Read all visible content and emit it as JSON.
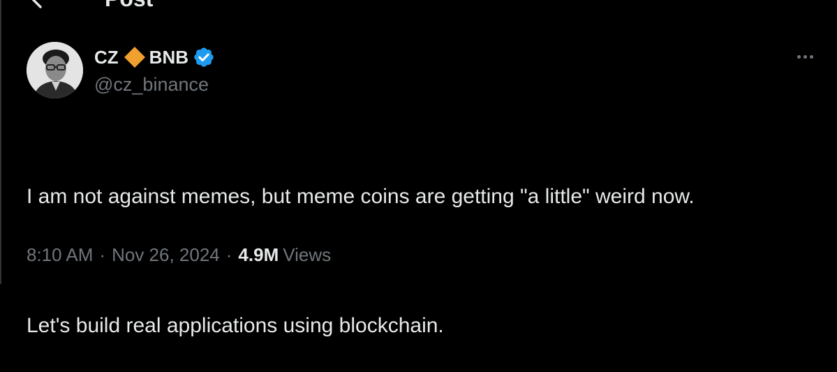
{
  "header": {
    "title": "Post",
    "back_icon": "arrow-left-icon"
  },
  "author": {
    "name_first": "CZ",
    "name_second": "BNB",
    "diamond_icon": "orange-diamond-icon",
    "diamond_color": "#f0a02f",
    "verified_icon": "verified-badge-icon",
    "verified_color": "#1d9bf0",
    "handle": "@cz_binance"
  },
  "post": {
    "text_line_1": "I am not against memes, but meme coins are getting \"a little\" weird now.",
    "text_line_2": "Let's build real applications using blockchain."
  },
  "meta": {
    "time": "8:10 AM",
    "separator": "·",
    "date": "Nov 26, 2024",
    "views_count": "4.9M",
    "views_label": "Views"
  },
  "more_icon": "more-horizontal-icon",
  "colors": {
    "background": "#000000",
    "text_primary": "#e7e9ea",
    "text_secondary": "#71767b"
  }
}
